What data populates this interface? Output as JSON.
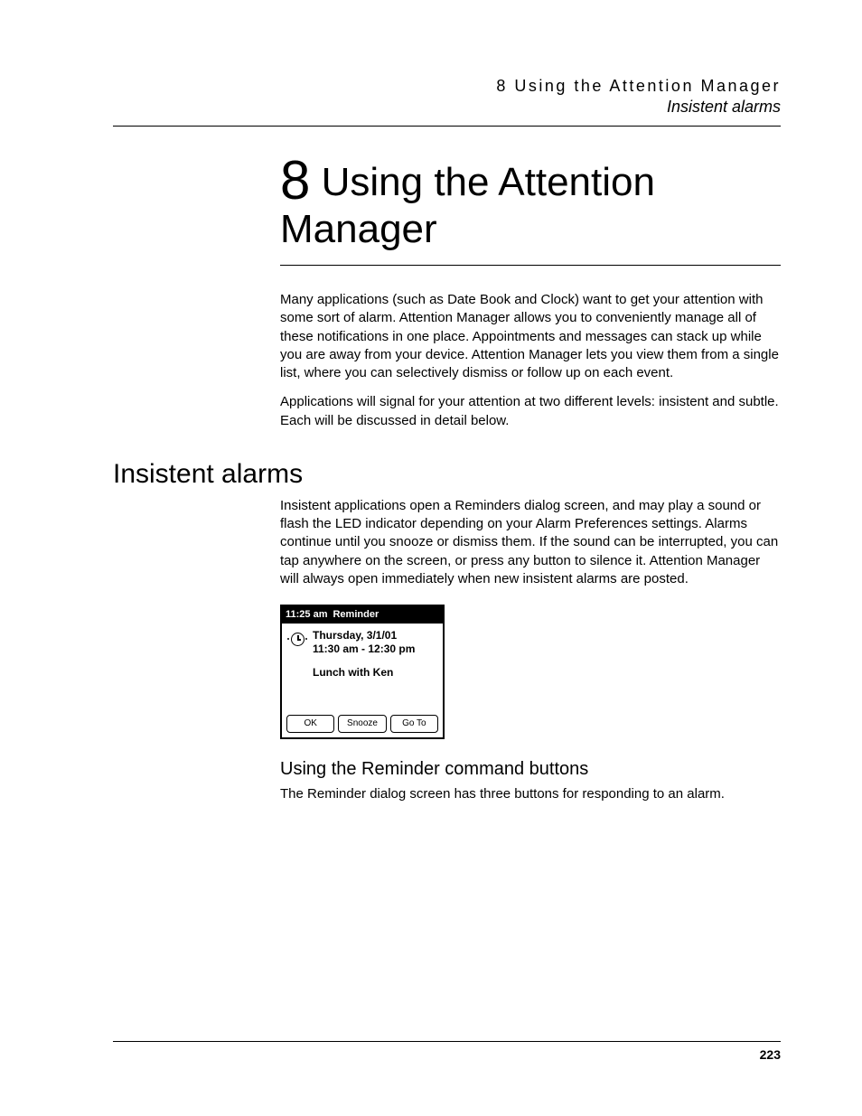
{
  "header": {
    "line1": "8 Using the Attention Manager",
    "line2": "Insistent alarms"
  },
  "chapter": {
    "number": "8",
    "title_line1": " Using the Attention",
    "title_line2": "Manager"
  },
  "intro": {
    "p1": "Many applications (such as Date Book and Clock) want to get your attention with some sort of alarm. Attention Manager allows you to conveniently manage all of these notifications in one place. Appointments and messages can stack up while you are away from your device. Attention Manager lets you view them from a single list, where you can selectively dismiss or follow up on each event.",
    "p2": "Applications will signal for your attention at two different levels: insistent and subtle. Each will be discussed in detail below."
  },
  "section": {
    "heading": "Insistent alarms",
    "p1": "Insistent applications open a Reminders dialog screen, and may play a sound or flash the LED indicator depending on your Alarm Preferences settings. Alarms continue until you snooze or dismiss them. If the sound can be interrupted, you can tap anywhere on the screen, or press any button to silence it. Attention Manager will always open immediately when new insistent alarms are posted."
  },
  "dialog": {
    "time": "11:25 am",
    "title": "Reminder",
    "date": "Thursday, 3/1/01",
    "range": "11:30 am - 12:30 pm",
    "subject": "Lunch with Ken",
    "buttons": {
      "ok": "OK",
      "snooze": "Snooze",
      "goto": "Go To"
    }
  },
  "subsection": {
    "heading": "Using the Reminder command buttons",
    "p1": "The Reminder dialog screen has three buttons for responding to an alarm."
  },
  "footer": {
    "page": "223"
  }
}
